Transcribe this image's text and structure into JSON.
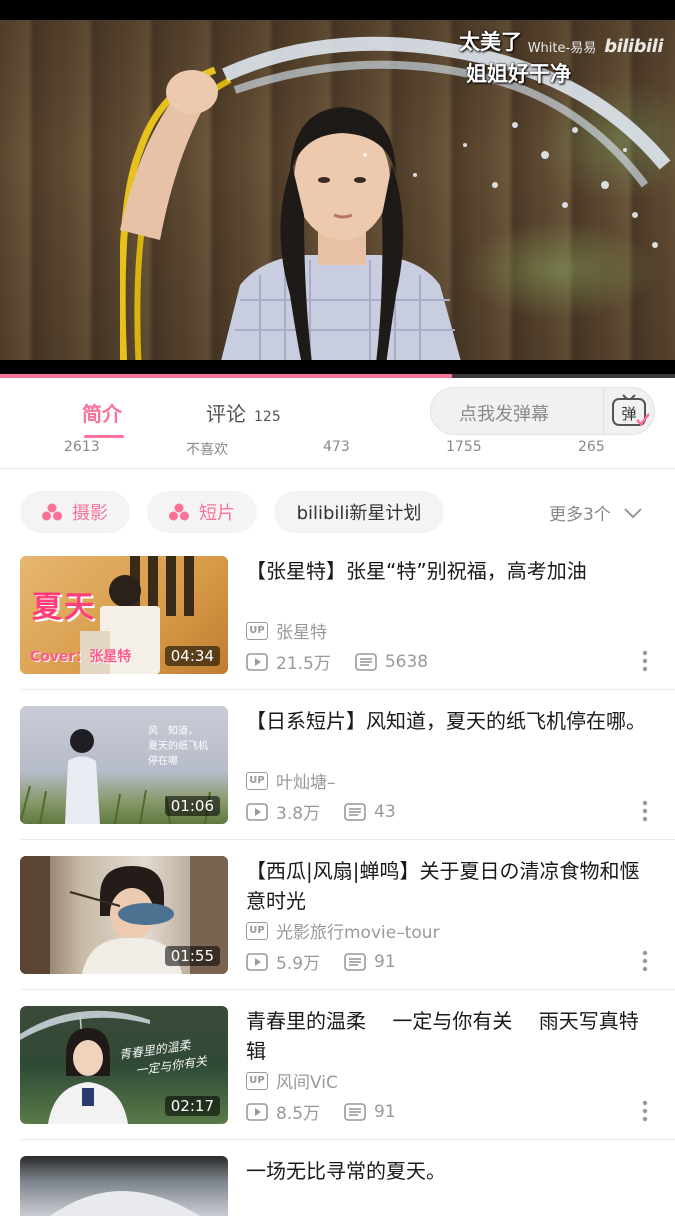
{
  "player": {
    "danmaku": [
      "太美了",
      "姐姐好干净"
    ],
    "watermark_user": "White-易易",
    "watermark_logo": "bilibili",
    "progress": 0.67
  },
  "tabs": {
    "intro_label": "简介",
    "comments_label": "评论",
    "comments_count": "125",
    "danmaku_placeholder": "点我发弹幕",
    "danmaku_button_icon": "弹"
  },
  "stats": [
    "2613",
    "不喜欢",
    "473",
    "1755",
    "265"
  ],
  "tags": {
    "items": [
      {
        "label": "摄影",
        "icon": "channel-icon"
      },
      {
        "label": "短片",
        "icon": "channel-icon"
      },
      {
        "label": "bilibili新星计划",
        "icon": ""
      }
    ],
    "more_label": "更多3个"
  },
  "videos": [
    {
      "title": "【张星特】张星“特”别祝福，高考加油",
      "uploader": "张星特",
      "views": "21.5万",
      "danmaku": "5638",
      "duration": "04:34",
      "thumb_text_big": "夏天",
      "thumb_text_small": "Cover：张星特"
    },
    {
      "title": "【日系短片】风知道，夏天的纸飞机停在哪。",
      "uploader": "叶灿塘–",
      "views": "3.8万",
      "danmaku": "43",
      "duration": "01:06",
      "thumb_poem": [
        "风　知道，",
        "夏天的纸飞机",
        "停在哪"
      ]
    },
    {
      "title": "【西瓜|风扇|蝉鸣】关于夏日の清凉食物和惬意时光",
      "uploader": "光影旅行movie–tour",
      "views": "5.9万",
      "danmaku": "91",
      "duration": "01:55"
    },
    {
      "title": "青春里的温柔　 一定与你有关　 雨天写真特辑",
      "uploader": "风间ViC",
      "views": "8.5万",
      "danmaku": "91",
      "duration": "02:17",
      "thumb_script": [
        "青春里的温柔",
        "一定与你有关"
      ]
    },
    {
      "title": "一场无比寻常的夏天。"
    }
  ],
  "colors": {
    "accent": "#fb7299",
    "muted": "#999999"
  },
  "icons": {
    "up": "UP",
    "play": "play-count-icon",
    "danmaku": "danmaku-count-icon",
    "more": "more-vertical-icon",
    "chevron": "chevron-down-icon"
  }
}
